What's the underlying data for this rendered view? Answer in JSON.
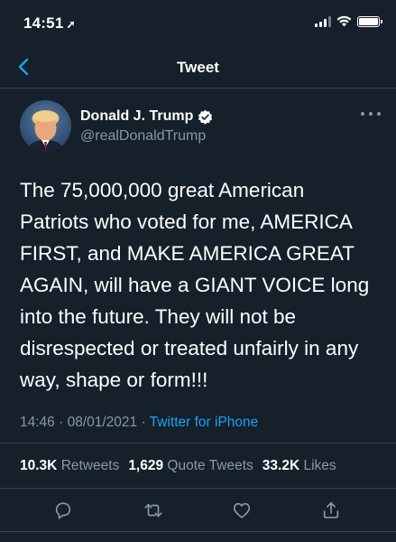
{
  "status_bar": {
    "time": "14:51",
    "location_icon": "location-arrow-icon",
    "icons": [
      "cellular-signal-icon",
      "wifi-icon",
      "battery-icon"
    ]
  },
  "nav": {
    "back_icon": "chevron-left-icon",
    "title": "Tweet"
  },
  "author": {
    "name": "Donald J. Trump",
    "handle": "@realDonaldTrump",
    "verified_icon": "verified-badge-icon",
    "more_icon": "more-horizontal-icon"
  },
  "tweet": {
    "text": "The 75,000,000 great American\nPatriots who voted for me, AMERICA\nFIRST, and MAKE AMERICA GREAT\nAGAIN, will have a GIANT VOICE long\ninto the future. They will not be\ndisrespected or treated unfairly in any\nway, shape or form!!!",
    "time": "14:46",
    "sep1": " · ",
    "date": "08/01/2021",
    "sep2": " · ",
    "source": "Twitter for iPhone"
  },
  "stats": {
    "retweets_count": "10.3K",
    "retweets_label": "Retweets",
    "quotes_count": "1,629",
    "quotes_label": "Quote Tweets",
    "likes_count": "33.2K",
    "likes_label": "Likes"
  },
  "actions": [
    "reply-icon",
    "retweet-icon",
    "like-icon",
    "share-icon"
  ],
  "colors": {
    "background": "#15202b",
    "secondary_text": "#8899a6",
    "accent": "#1da1f2",
    "divider": "#38444d"
  }
}
